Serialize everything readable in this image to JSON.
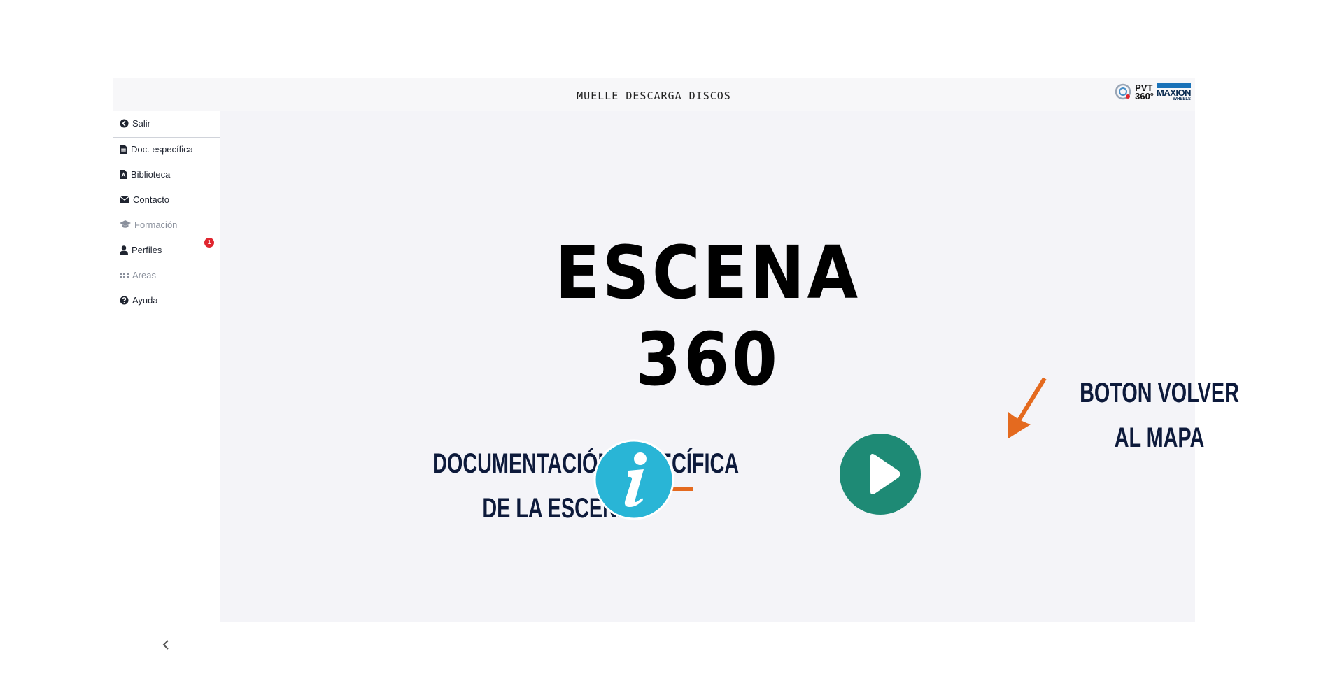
{
  "header": {
    "title": "MUELLE DESCARGA DISCOS",
    "logo_pvt_line1": "PVT",
    "logo_pvt_line2": "360°",
    "logo_maxion": "MAXION",
    "logo_maxion_sub": "WHEELS"
  },
  "sidebar": {
    "items": [
      {
        "label": "Salir",
        "icon": "arrow-left-circle-icon",
        "enabled": true
      },
      {
        "label": "Doc. específica",
        "icon": "file-icon",
        "enabled": true
      },
      {
        "label": "Biblioteca",
        "icon": "file-pdf-icon",
        "enabled": true
      },
      {
        "label": "Contacto",
        "icon": "envelope-icon",
        "enabled": true
      },
      {
        "label": "Formación",
        "icon": "graduation-cap-icon",
        "enabled": false
      },
      {
        "label": "Perfiles",
        "icon": "user-icon",
        "enabled": true,
        "badge": "1"
      },
      {
        "label": "Areas",
        "icon": "grid-icon",
        "enabled": false
      },
      {
        "label": "Ayuda",
        "icon": "question-circle-icon",
        "enabled": true
      }
    ],
    "collapse_icon": "chevron-left-icon"
  },
  "main": {
    "scene_line1": "ESCENA",
    "scene_line2": "360",
    "doc_label_line1": "DOCUMENTACIÓN ESPECÍFICA",
    "doc_label_line2": "DE LA ESCENA",
    "back_label_line1": "BOTON VOLVER",
    "back_label_line2": "AL MAPA",
    "info_button_icon": "info-icon",
    "play_button_icon": "play-icon"
  },
  "colors": {
    "info_button": "#29b5d6",
    "play_button": "#1e8a75",
    "arrow": "#e46a1f",
    "label_text": "#0d1a3b",
    "badge": "#e0262f"
  }
}
